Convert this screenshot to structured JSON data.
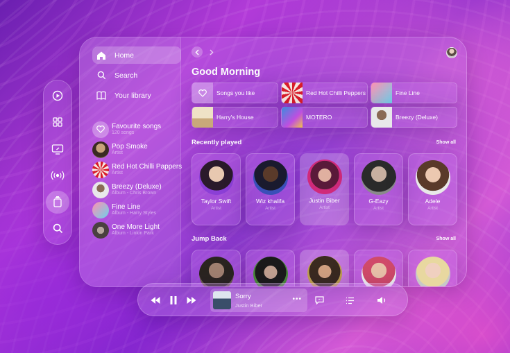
{
  "sidebar": {
    "nav": [
      {
        "label": "Home",
        "icon": "home-icon",
        "active": true
      },
      {
        "label": "Search",
        "icon": "search-icon",
        "active": false
      },
      {
        "label": "Your library",
        "icon": "library-icon",
        "active": false
      }
    ],
    "library": [
      {
        "title": "Favourite songs",
        "subtitle": "120 songs"
      },
      {
        "title": "Pop Smoke",
        "subtitle": "Artist"
      },
      {
        "title": "Red Hot Chilli Pappers",
        "subtitle": "Artist"
      },
      {
        "title": "Breezy (Deluxe)",
        "subtitle": "Album - Chris Brown"
      },
      {
        "title": "Fine Line",
        "subtitle": "Album - Harry Styles"
      },
      {
        "title": "One More Light",
        "subtitle": "Album - Linkin Park"
      }
    ]
  },
  "rail": [
    "play-circle-icon",
    "grid-icon",
    "monitor-icon",
    "broadcast-icon",
    "library-icon",
    "search-icon"
  ],
  "main": {
    "greeting": "Good Morning",
    "quick_access": [
      {
        "label": "Songs you like"
      },
      {
        "label": "Red Hot Chilli Peppers"
      },
      {
        "label": "Fine Line"
      },
      {
        "label": "Harry's House"
      },
      {
        "label": "MOTERO"
      },
      {
        "label": "Breezy (Deluxe)"
      }
    ],
    "recently_played": {
      "title": "Recently played",
      "show_all": "Show all",
      "items": [
        {
          "name": "Taylor Swift",
          "type": "Artist"
        },
        {
          "name": "Wiz khalifa",
          "type": "Artist"
        },
        {
          "name": "Justin Biber",
          "type": "Artist"
        },
        {
          "name": "G-Eazy",
          "type": "Artist"
        },
        {
          "name": "Adele",
          "type": "Artist"
        }
      ]
    },
    "jump_back": {
      "title": "Jump Back",
      "show_all": "Show all"
    }
  },
  "player": {
    "title": "Sorry",
    "artist": "Justin Biber",
    "more": "•••"
  },
  "colors": {
    "accent": "#b23bd8",
    "background": "#7c25c9"
  }
}
